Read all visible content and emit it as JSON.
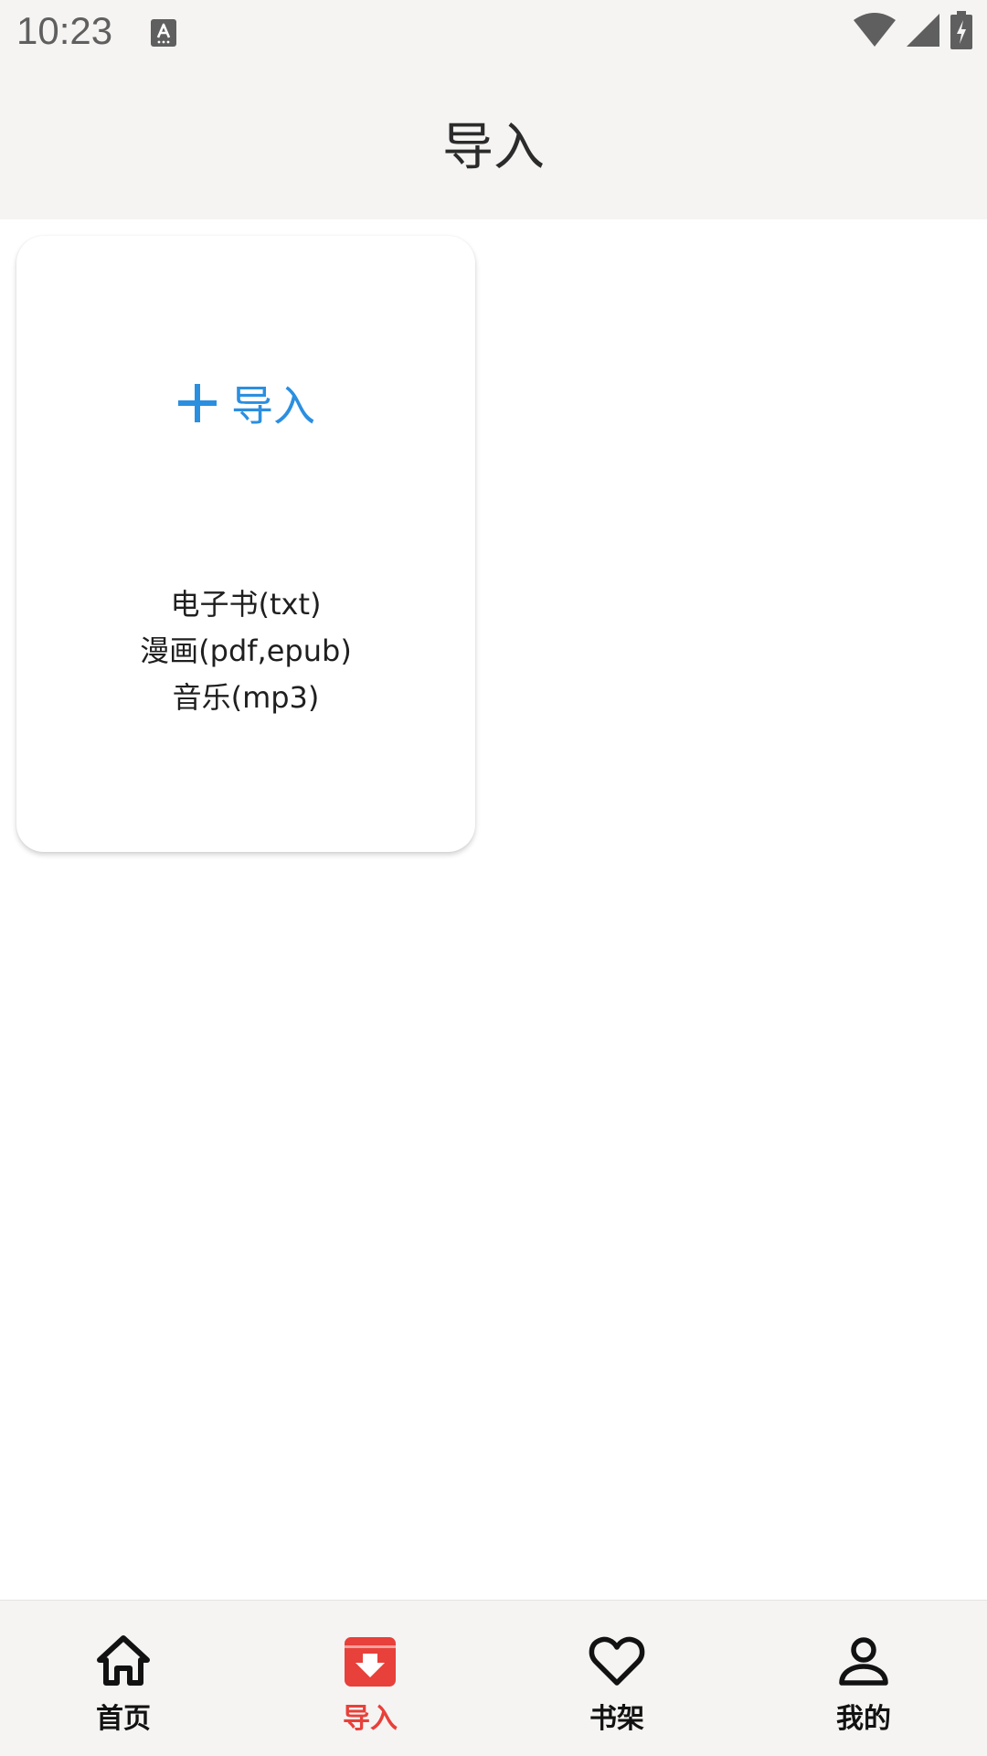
{
  "status_bar": {
    "time": "10:23",
    "notification_icon": "text-input-icon",
    "icons": [
      "wifi-icon",
      "signal-icon",
      "battery-charging-icon"
    ]
  },
  "app_bar": {
    "title": "导入"
  },
  "import_card": {
    "action_icon": "plus-icon",
    "action_label": "导入",
    "formats": [
      "电子书(txt)",
      "漫画(pdf,epub)",
      "音乐(mp3)"
    ]
  },
  "bottom_nav": {
    "items": [
      {
        "label": "首页",
        "icon": "home-icon",
        "active": false
      },
      {
        "label": "导入",
        "icon": "import-icon",
        "active": true
      },
      {
        "label": "书架",
        "icon": "heart-icon",
        "active": false
      },
      {
        "label": "我的",
        "icon": "person-icon",
        "active": false
      }
    ]
  },
  "colors": {
    "accent_blue": "#2b8fe0",
    "active_red": "#e8403a",
    "bar_background": "#f5f4f3"
  }
}
